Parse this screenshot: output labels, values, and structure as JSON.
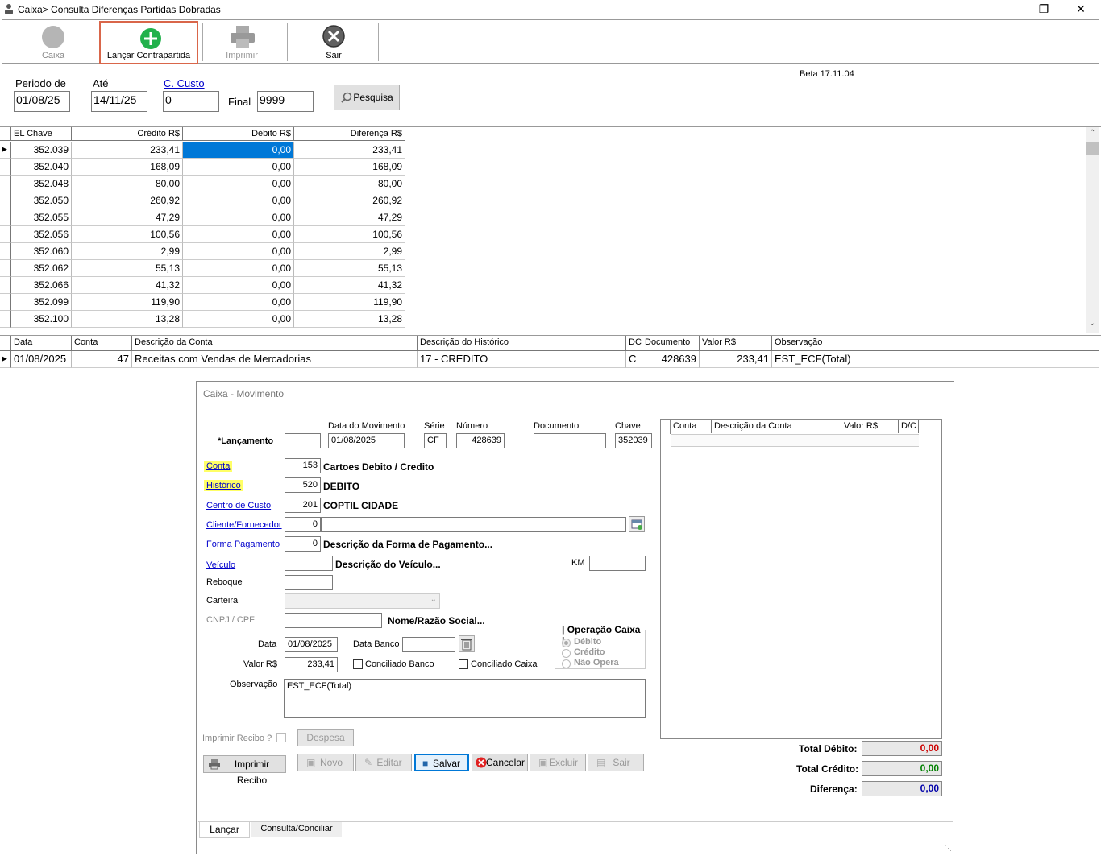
{
  "window": {
    "title": "Caixa> Consulta Diferenças Partidas Dobradas",
    "version": "Beta 17.11.04"
  },
  "toolbar": {
    "caixa": "Caixa",
    "lancar": "Lançar Contrapartida",
    "imprimir": "Imprimir",
    "sair": "Sair"
  },
  "filter": {
    "periodo_label": "Periodo de",
    "periodo_value": "01/08/25",
    "ate_label": "Até",
    "ate_value": "14/11/25",
    "ccusto_label": "C. Custo",
    "ccusto_value": "0",
    "final_label": "Final",
    "final_value": "9999",
    "pesquisa": "Pesquisa"
  },
  "grid1": {
    "headers": [
      "EL Chave",
      "Crédito R$",
      "Débito R$",
      "Diferença R$"
    ],
    "rows": [
      [
        "352.039",
        "233,41",
        "0,00",
        "233,41"
      ],
      [
        "352.040",
        "168,09",
        "0,00",
        "168,09"
      ],
      [
        "352.048",
        "80,00",
        "0,00",
        "80,00"
      ],
      [
        "352.050",
        "260,92",
        "0,00",
        "260,92"
      ],
      [
        "352.055",
        "47,29",
        "0,00",
        "47,29"
      ],
      [
        "352.056",
        "100,56",
        "0,00",
        "100,56"
      ],
      [
        "352.060",
        "2,99",
        "0,00",
        "2,99"
      ],
      [
        "352.062",
        "55,13",
        "0,00",
        "55,13"
      ],
      [
        "352.066",
        "41,32",
        "0,00",
        "41,32"
      ],
      [
        "352.099",
        "119,90",
        "0,00",
        "119,90"
      ],
      [
        "352.100",
        "13,28",
        "0,00",
        "13,28"
      ]
    ]
  },
  "grid2": {
    "headers": [
      "Data",
      "Conta",
      "Descrição da Conta",
      "Descrição do Histórico",
      "DC",
      "Documento",
      "Valor R$",
      "Observação"
    ],
    "rows": [
      [
        "01/08/2025",
        "47",
        "Receitas com Vendas de Mercadorias",
        "17 - CREDITO",
        "C",
        "428639",
        "233,41",
        "EST_ECF(Total)"
      ]
    ]
  },
  "dialog": {
    "title": "Caixa - Movimento",
    "lancamento_label": "*Lançamento",
    "lancamento_value": "",
    "data_mov_label": "Data do Movimento",
    "data_mov_value": "01/08/2025",
    "serie_label": "Série",
    "serie_value": "CF",
    "numero_label": "Número",
    "numero_value": "428639",
    "documento_label": "Documento",
    "documento_value": "",
    "chave_label": "Chave",
    "chave_value": "352039",
    "conta_label": "Conta",
    "conta_value": "153",
    "conta_desc": "Cartoes Debito / Credito",
    "historico_label": "Histórico",
    "historico_value": "520",
    "historico_desc": "DEBITO",
    "centro_label": "Centro de Custo",
    "centro_value": "201",
    "centro_desc": "COPTIL CIDADE",
    "cliente_label": "Cliente/Fornecedor",
    "cliente_value": "0",
    "cliente_desc": "",
    "forma_label": "Forma Pagamento",
    "forma_value": "0",
    "forma_desc": "Descrição da Forma de Pagamento...",
    "veiculo_label": "Veículo",
    "veiculo_value": "",
    "veiculo_desc": "Descrição do Veículo...",
    "km_label": "KM",
    "km_value": "",
    "reboque_label": "Reboque",
    "reboque_value": "",
    "carteira_label": "Carteira",
    "carteira_value": "",
    "cnpj_label": "CNPJ / CPF",
    "cnpj_value": "",
    "nome_desc": "Nome/Razão Social...",
    "data_label": "Data",
    "data_value": "01/08/2025",
    "data_banco_label": "Data Banco",
    "data_banco_value": "",
    "valor_label": "Valor R$",
    "valor_value": "233,41",
    "conciliado_banco": "Conciliado Banco",
    "conciliado_caixa": "Conciliado Caixa",
    "operacao_label": "Operação Caixa",
    "op_debito": "Débito",
    "op_credito": "Crédito",
    "op_nao": "Não Opera",
    "observacao_label": "Observação",
    "observacao_value": "EST_ECF(Total)",
    "imprimir_recibo_q": "Imprimir Recibo ?",
    "despesa": "Despesa",
    "imprimir_recibo": "Imprimir Recibo",
    "novo": "Novo",
    "editar": "Editar",
    "salvar": "Salvar",
    "cancelar": "Cancelar",
    "excluir": "Excluir",
    "sair": "Sair",
    "grid_headers": [
      "Conta",
      "Descrição da Conta",
      "Valor R$",
      "D/C"
    ],
    "total_debito_label": "Total Débito:",
    "total_debito_value": "0,00",
    "total_credito_label": "Total Crédito:",
    "total_credito_value": "0,00",
    "diferenca_label": "Diferença:",
    "diferenca_value": "0,00",
    "tab_lancar": "Lançar",
    "tab_consulta": "Consulta/Conciliar"
  }
}
